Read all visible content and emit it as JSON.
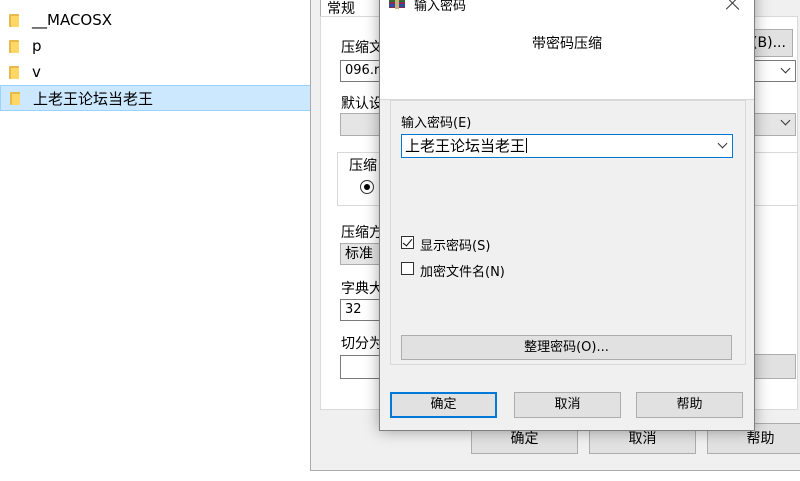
{
  "explorer": {
    "items": [
      {
        "label": "__MACOSX",
        "selected": false
      },
      {
        "label": "p",
        "selected": false
      },
      {
        "label": "v",
        "selected": false
      },
      {
        "label": "上老王论坛当老王",
        "selected": true
      }
    ]
  },
  "background_dialog": {
    "tab_general": "常规",
    "archive_label": "压缩文",
    "browse_button": "(B)...",
    "filename_value": "096.r",
    "default_label": "默认设",
    "format_group_label": "压缩",
    "method_label": "压缩方",
    "method_value": "标准",
    "dict_label": "字典大",
    "dict_value": "32",
    "split_label": "切分为",
    "ok": "确定",
    "cancel": "取消",
    "help": "帮助"
  },
  "password_dialog": {
    "title": "输入密码",
    "heading": "带密码压缩",
    "password_label": "输入密码(E)",
    "password_value": "上老王论坛当老王",
    "show_password_label": "显示密码(S)",
    "show_password_checked": true,
    "encrypt_filenames_label": "加密文件名(N)",
    "encrypt_filenames_checked": false,
    "organize_button": "整理密码(O)...",
    "ok": "确定",
    "cancel": "取消",
    "help": "帮助"
  },
  "colors": {
    "accent": "#0078d7",
    "selection": "#cce8ff",
    "dialog_bg": "#f0f0f0"
  }
}
